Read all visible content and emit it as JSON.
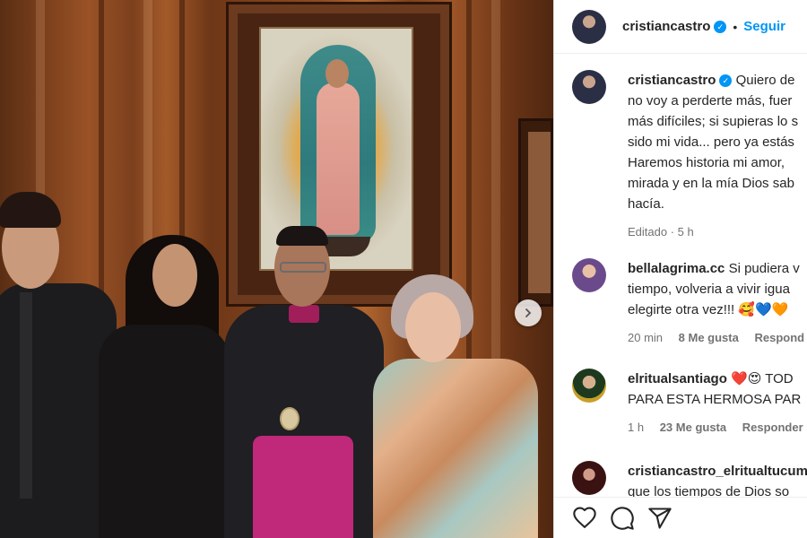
{
  "post": {
    "username": "cristiancastro",
    "follow_label": "Seguir",
    "dot": "•",
    "verified_mark": "✓",
    "caption_lines": [
      "Quiero de",
      "no voy a perderte más, fuer",
      "más difíciles; si supieras lo s",
      "sido mi vida... pero ya estás",
      "Haremos historia mi amor,",
      "mirada y en la mía Dios sab",
      "hacía."
    ],
    "caption_meta": "Editado · 5 h"
  },
  "comments": [
    {
      "username": "bellalagrima.cc",
      "lines": [
        "Si pudiera v",
        "tiempo, volveria a vivir igua",
        "elegirte otra vez!!! 🥰💙🧡"
      ],
      "time": "20 min",
      "likes": "8 Me gusta",
      "reply": "Respond"
    },
    {
      "username": "elritualsantiago",
      "lines": [
        "❤️😍 TOD",
        "PARA ESTA HERMOSA PAR"
      ],
      "time": "1 h",
      "likes": "23 Me gusta",
      "reply": "Responder"
    },
    {
      "username": "cristiancastro_elritualtucum",
      "lines": [
        "que los tiempos de Dios so"
      ]
    }
  ],
  "icons": {
    "like": "heart-icon",
    "comment": "comment-icon",
    "share": "share-icon",
    "carousel": "chevron-right-icon"
  },
  "colors": {
    "accent": "#0095f6",
    "text": "#262626",
    "meta": "#737373"
  }
}
